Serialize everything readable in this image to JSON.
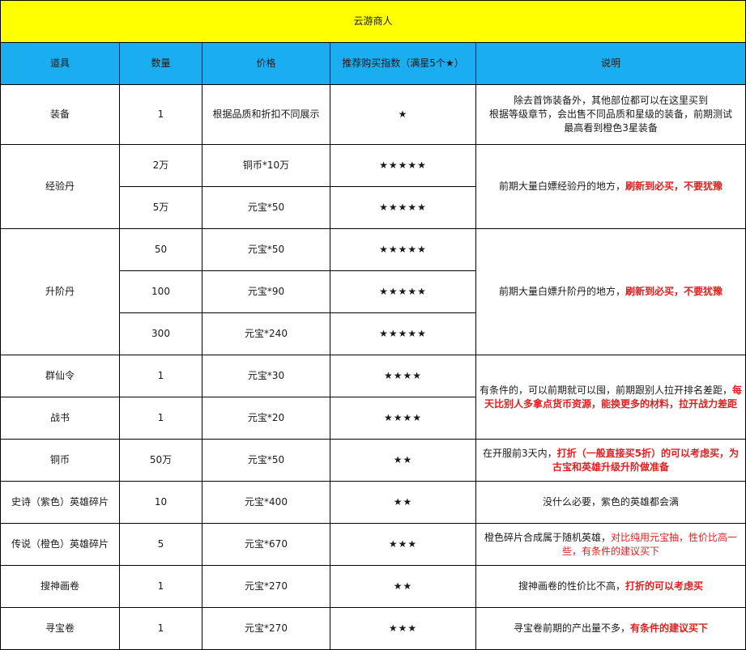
{
  "title": "云游商人",
  "headers": [
    "道具",
    "数量",
    "价格",
    "推荐购买指数（满星5个★）",
    "说明"
  ],
  "rows": {
    "r0": {
      "item": "装备",
      "qty": "1",
      "price": "根据品质和折扣不同展示",
      "stars": "★"
    },
    "r1": {
      "item": "经验丹",
      "qty": "2万",
      "price": "铜币*10万",
      "stars": "★★★★★"
    },
    "r2": {
      "qty": "5万",
      "price": "元宝*50",
      "stars": "★★★★★"
    },
    "r3": {
      "item": "升阶丹",
      "qty": "50",
      "price": "元宝*50",
      "stars": "★★★★★"
    },
    "r4": {
      "qty": "100",
      "price": "元宝*90",
      "stars": "★★★★★"
    },
    "r5": {
      "qty": "300",
      "price": "元宝*240",
      "stars": "★★★★★"
    },
    "r6": {
      "item": "群仙令",
      "qty": "1",
      "price": "元宝*30",
      "stars": "★★★★"
    },
    "r7": {
      "item": "战书",
      "qty": "1",
      "price": "元宝*20",
      "stars": "★★★★"
    },
    "r8": {
      "item": "铜币",
      "qty": "50万",
      "price": "元宝*50",
      "stars": "★★"
    },
    "r9": {
      "item": "史诗（紫色）英雄碎片",
      "qty": "10",
      "price": "元宝*400",
      "stars": "★★"
    },
    "r10": {
      "item": "传说（橙色）英雄碎片",
      "qty": "5",
      "price": "元宝*670",
      "stars": "★★★"
    },
    "r11": {
      "item": "搜神画卷",
      "qty": "1",
      "price": "元宝*270",
      "stars": "★★"
    },
    "r12": {
      "item": "寻宝卷",
      "qty": "1",
      "price": "元宝*270",
      "stars": "★★★"
    }
  },
  "desc": {
    "equip": {
      "l1": "除去首饰装备外，其他部位都可以在这里买到",
      "l2": "根据等级章节，会出售不同品质和星级的装备，前期测试",
      "l3": "最高看到橙色3星装备"
    },
    "exp": {
      "normal": "前期大量白嫖经验丹的地方，",
      "red": "刷新到必买，不要犹豫"
    },
    "upgrade": {
      "normal": "前期大量白嫖升阶丹的地方，",
      "red": "刷新到必买，不要犹豫"
    },
    "token": {
      "normal": "有条件的，可以前期就可以囤，前期跟别人拉开排名差距，",
      "red": "每天比别人多拿点货币资源，能换更多的材料，拉开战力差距"
    },
    "coin": {
      "normal": "在开服前3天内，",
      "red": "打折（一般直接买5折）的可以考虑买，为古宝和英雄升级升阶做准备"
    },
    "epic": {
      "normal": "没什么必要，紫色的英雄都会满"
    },
    "legend": {
      "normal": "橙色碎片合成属于随机英雄，",
      "red": "对比纯用元宝抽，性价比高一些，有条件的建议买下"
    },
    "scroll": {
      "normal": "搜神画卷的性价比不高，",
      "red": "打折的可以考虑买"
    },
    "treasure": {
      "normal": "寻宝卷前期的产出量不多，",
      "red": "有条件的建议买下"
    }
  },
  "colors": {
    "title_bg": "#ffff00",
    "header_bg": "#1aaef0",
    "highlight_text": "#e02020"
  }
}
